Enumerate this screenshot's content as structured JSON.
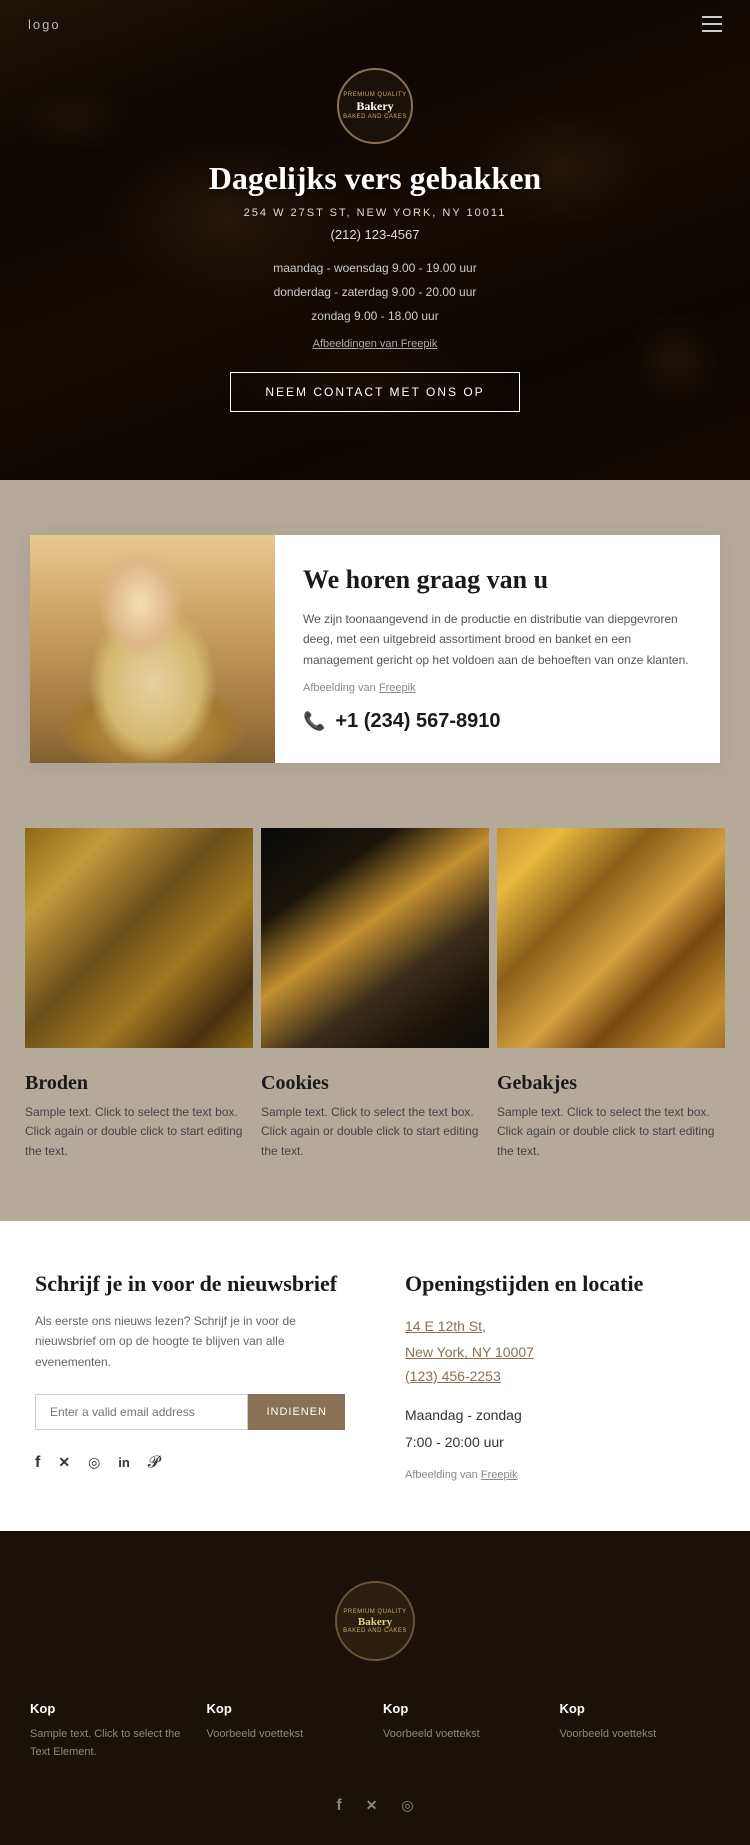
{
  "nav": {
    "logo": "logo",
    "menu_icon": "☰"
  },
  "hero": {
    "badge": {
      "top_text": "PREMIUM QUALITY",
      "name": "Bakery",
      "bottom_text": "BAKED AND CAKES"
    },
    "title": "Dagelijks vers gebakken",
    "address": "254 W 27ST ST, NEW YORK, NY 10011",
    "phone": "(212) 123-4567",
    "hours": [
      "maandag - woensdag 9.00 - 19.00 uur",
      "donderdag - zaterdag 9.00 - 20.00 uur",
      "zondag 9.00 - 18.00 uur"
    ],
    "freepik_text": "Afbeeldingen van Freepik",
    "cta_button": "NEEM CONTACT MET ONS OP"
  },
  "contact_section": {
    "heading": "We horen graag van u",
    "description": "We zijn toonaangevend in de productie en distributie van diepgevroren deeg, met een uitgebreid assortiment brood en banket en een management gericht op het voldoen aan de behoeften van onze klanten.",
    "freepik_text": "Afbeelding van",
    "freepik_link": "Freepik",
    "phone": "+1 (234) 567-8910"
  },
  "products": [
    {
      "name": "Broden",
      "description": "Sample text. Click to select the text box. Click again or double click to start editing the text."
    },
    {
      "name": "Cookies",
      "description": "Sample text. Click to select the text box. Click again or double click to start editing the text."
    },
    {
      "name": "Gebakjes",
      "description": "Sample text. Click to select the text box. Click again or double click to start editing the text."
    }
  ],
  "newsletter": {
    "title": "Schrijf je in voor de nieuwsbrief",
    "description": "Als eerste ons nieuws lezen? Schrijf je in voor de nieuwsbrief om op de hoogte te blijven van alle evenementen.",
    "input_placeholder": "Enter a valid email address",
    "button_label": "INDIENEN",
    "social_icons": [
      "f",
      "𝕏",
      "○",
      "in",
      "𝓟"
    ]
  },
  "opening_hours": {
    "title": "Openingstijden en locatie",
    "address_line1": "14 E 12th St,",
    "address_line2": "New York, NY 10007",
    "phone": "(123) 456-2253",
    "hours_label": "Maandag - zondag",
    "hours_time": "7:00 - 20:00 uur",
    "freepik_text": "Afbeelding van",
    "freepik_link": "Freepik"
  },
  "footer": {
    "badge": {
      "top_text": "PREMIUM QUALITY",
      "name": "Bakery",
      "bottom_text": "BAKED AND CAKES"
    },
    "columns": [
      {
        "title": "Kop",
        "text": "Sample text. Click to select the Text Element."
      },
      {
        "title": "Kop",
        "text": "Voorbeeld voettekst"
      },
      {
        "title": "Kop",
        "text": "Voorbeeld voettekst"
      },
      {
        "title": "Kop",
        "text": "Voorbeeld voettekst"
      }
    ],
    "social_icons": [
      "f",
      "𝕏",
      "○"
    ]
  }
}
